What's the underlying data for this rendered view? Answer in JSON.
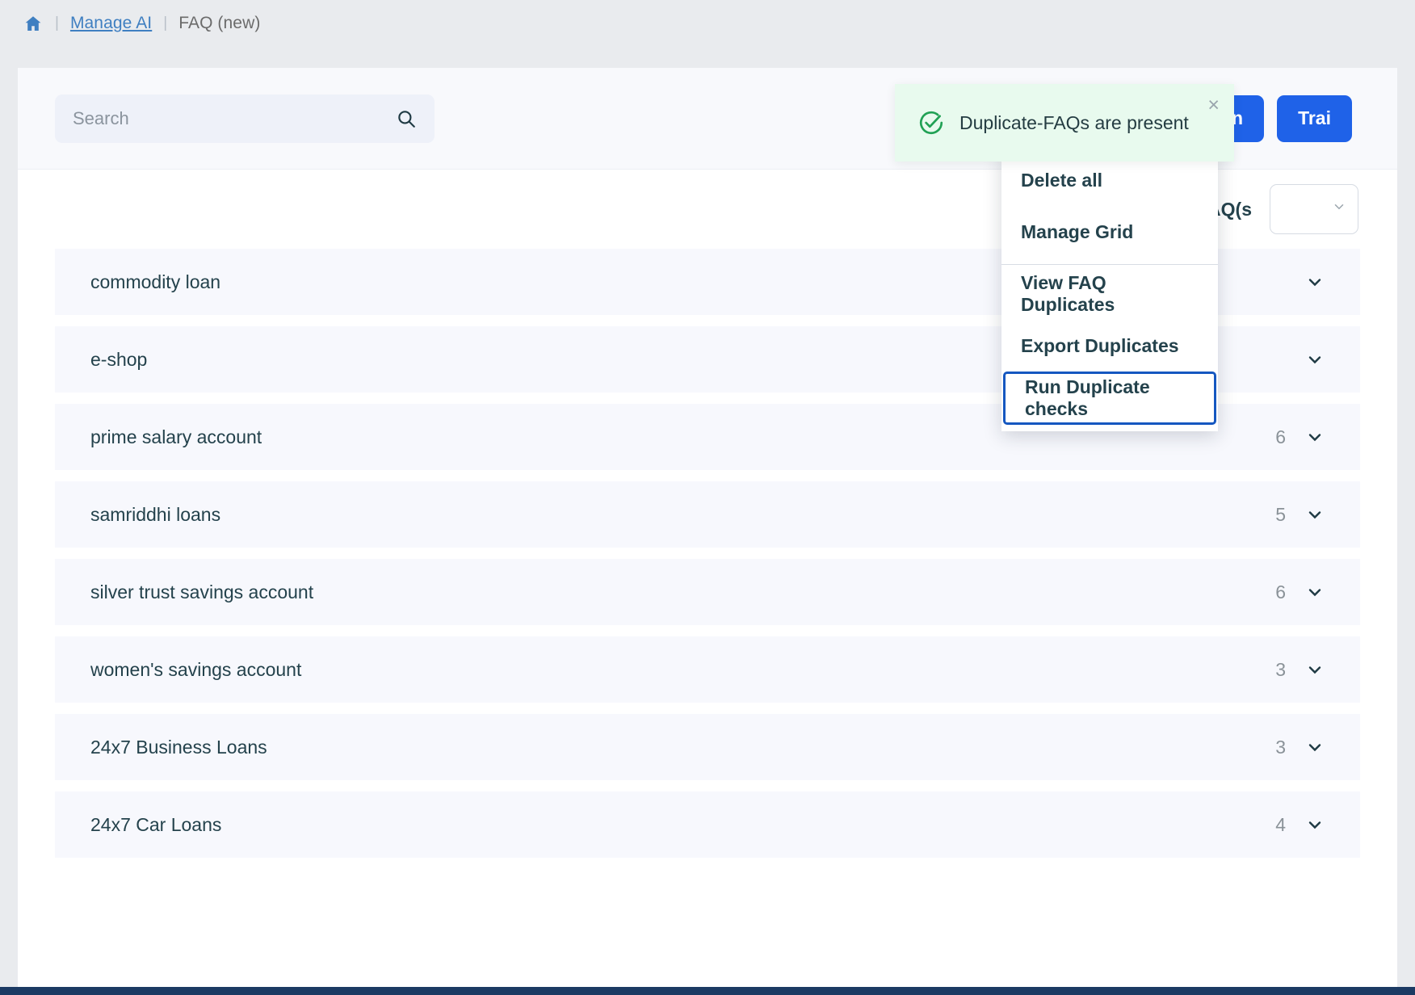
{
  "breadcrumb": {
    "home_icon": "home-icon",
    "separator": "|",
    "link": "Manage AI",
    "current": "FAQ (new)"
  },
  "toolbar": {
    "search": {
      "value": "",
      "placeholder": "Search",
      "icon": "search-icon"
    },
    "quick_train_label": "Quick Train",
    "quick_train_icon": "refresh-icon",
    "train_label": "Trai"
  },
  "summary": {
    "total_label": "Total FAQ(s",
    "page_size_value": ""
  },
  "toast": {
    "message": "Duplicate-FAQs are present",
    "icon": "circle-check-icon",
    "close_label": "×",
    "bg_color": "#e8faee",
    "icon_color": "#21a155"
  },
  "dropdown": {
    "items": [
      {
        "label": "Delete all",
        "focused": false
      },
      {
        "label": "Manage Grid",
        "focused": false
      },
      {
        "label": "View FAQ Duplicates",
        "focused": false
      },
      {
        "label": "Export Duplicates",
        "focused": false
      },
      {
        "label": "Run Duplicate checks",
        "focused": true
      }
    ],
    "focus_color": "#1557c0"
  },
  "faq_list": {
    "rows": [
      {
        "title": "commodity loan",
        "count": ""
      },
      {
        "title": "e-shop",
        "count": ""
      },
      {
        "title": "prime salary account",
        "count": "6"
      },
      {
        "title": "samriddhi loans",
        "count": "5"
      },
      {
        "title": "silver trust savings account",
        "count": "6"
      },
      {
        "title": "women's savings account",
        "count": "3"
      },
      {
        "title": "24x7 Business Loans",
        "count": "3"
      },
      {
        "title": "24x7 Car Loans",
        "count": "4"
      }
    ]
  },
  "colors": {
    "accent": "#1f62e8",
    "link": "#3f7fc1",
    "text": "#24424c",
    "row_bg": "#f7f8fd"
  }
}
